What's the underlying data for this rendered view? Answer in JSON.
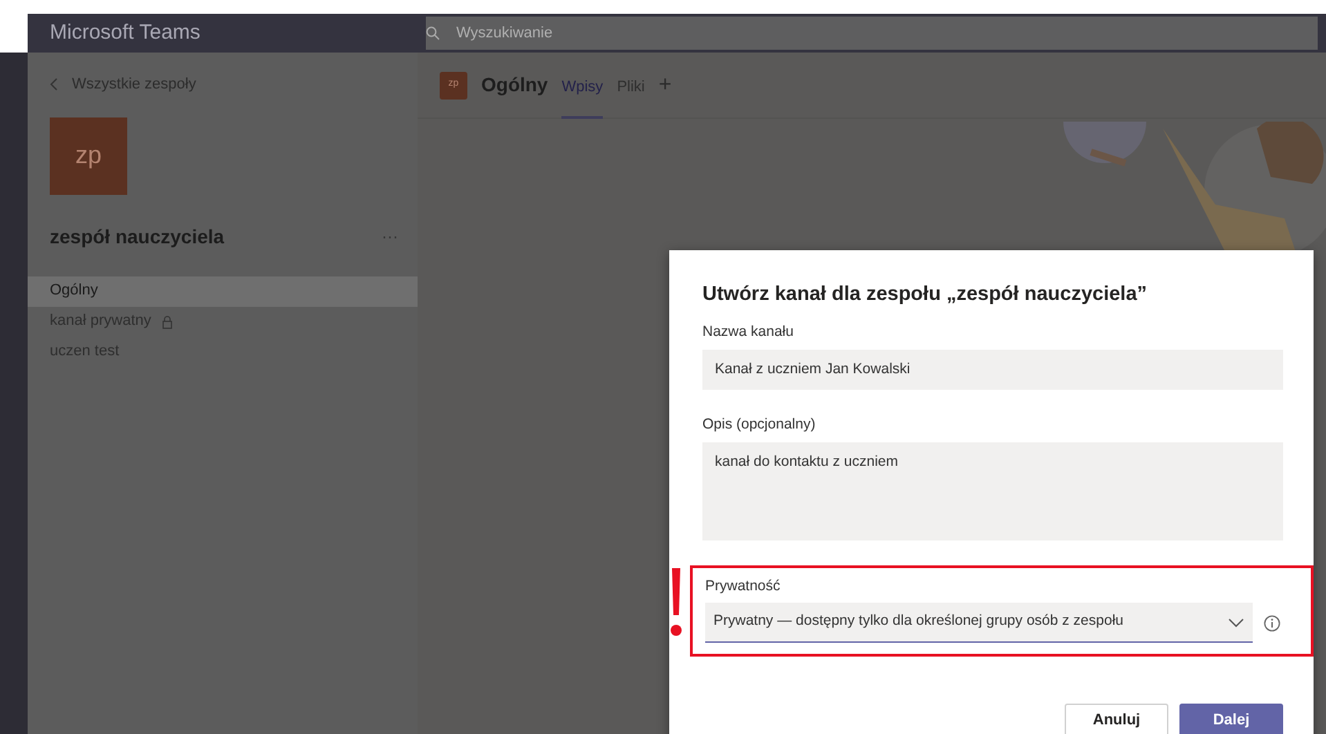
{
  "app": {
    "title": "Microsoft Teams",
    "search": {
      "placeholder": "Wyszukiwanie"
    }
  },
  "sidebar": {
    "back_link": "Wszystkie zespoły",
    "team_avatar": "zp",
    "team_name": "zespół nauczyciela",
    "more": "···",
    "channels": [
      {
        "name": "Ogólny",
        "selected": true,
        "locked": false
      },
      {
        "name": "kanał prywatny",
        "selected": false,
        "locked": true
      },
      {
        "name": "uczen test",
        "selected": false,
        "locked": false
      }
    ]
  },
  "channel_header": {
    "avatar": "zp",
    "title": "Ogólny",
    "tabs": [
      {
        "label": "Wpisy",
        "selected": true
      },
      {
        "label": "Pliki",
        "selected": false
      }
    ],
    "add_tab": "+"
  },
  "dialog": {
    "title": "Utwórz kanał dla zespołu „zespół nauczyciela”",
    "name_label": "Nazwa kanału",
    "name_value": "Kanał z uczniem Jan Kowalski",
    "description_label": "Opis (opcjonalny)",
    "description_value": "kanał do kontaktu z uczniem",
    "privacy_label": "Prywatność",
    "privacy_value": "Prywatny — dostępny tylko dla określonej grupy osób z zespołu",
    "privacy_highlighted": true,
    "buttons": [
      {
        "label": "Anuluj",
        "kind": "secondary"
      },
      {
        "label": "Dalej",
        "kind": "primary"
      }
    ]
  }
}
